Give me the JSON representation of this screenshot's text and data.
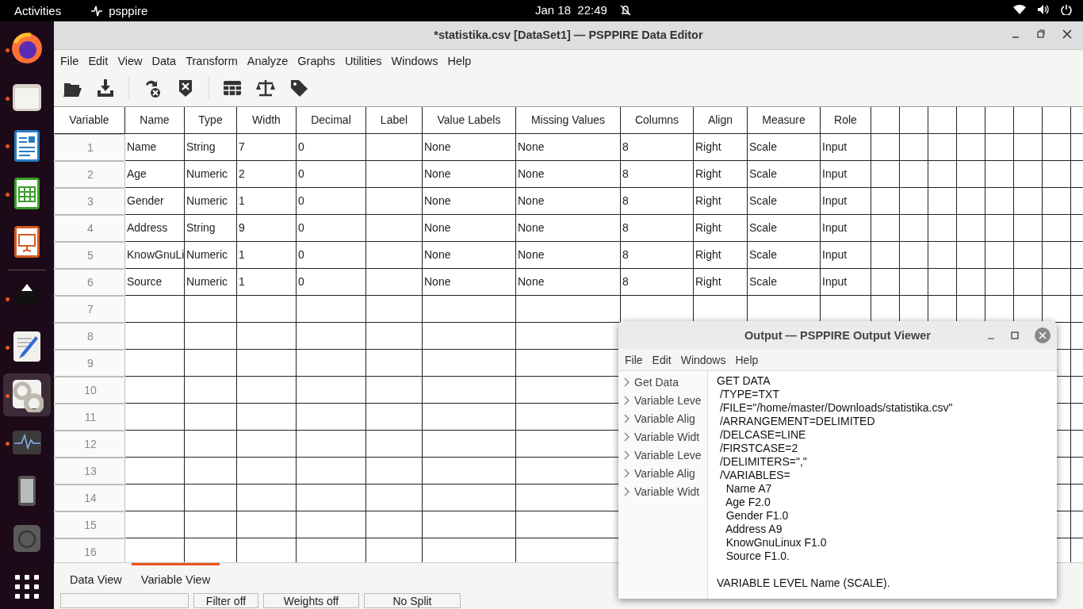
{
  "top_bar": {
    "activities": "Activities",
    "app_name": "psppire",
    "clock": "Jan 18  22:49"
  },
  "dock": [
    {
      "kind": "browser",
      "running": true,
      "selected": false
    },
    {
      "kind": "files",
      "running": true,
      "selected": false
    },
    {
      "kind": "writer",
      "running": true,
      "selected": false
    },
    {
      "kind": "calc",
      "running": true,
      "selected": false
    },
    {
      "kind": "impress",
      "running": false,
      "selected": false
    },
    {
      "kind": "separator"
    },
    {
      "kind": "inkscape",
      "running": true,
      "selected": false
    },
    {
      "kind": "editor",
      "running": true,
      "selected": false
    },
    {
      "kind": "psppire",
      "running": true,
      "selected": true
    },
    {
      "kind": "monitor",
      "running": true,
      "selected": false
    },
    {
      "kind": "phone",
      "running": false,
      "selected": false
    },
    {
      "kind": "disc",
      "running": false,
      "selected": false
    },
    {
      "kind": "apps",
      "running": false,
      "selected": false
    }
  ],
  "editor": {
    "title": "*statistika.csv [DataSet1] — PSPPIRE Data Editor",
    "menu": [
      "File",
      "Edit",
      "View",
      "Data",
      "Transform",
      "Analyze",
      "Graphs",
      "Utilities",
      "Windows",
      "Help"
    ],
    "columns": [
      "Variable",
      "Name",
      "Type",
      "Width",
      "Decimal",
      "Label",
      "Value Labels",
      "Missing Values",
      "Columns",
      "Align",
      "Measure",
      "Role"
    ],
    "rows": [
      {
        "number": "1",
        "cells": [
          "Name",
          "String",
          "7",
          "0",
          "",
          "None",
          "None",
          "8",
          "Right",
          "Scale",
          "Input"
        ]
      },
      {
        "number": "2",
        "cells": [
          "Age",
          "Numeric",
          "2",
          "0",
          "",
          "None",
          "None",
          "8",
          "Right",
          "Scale",
          "Input"
        ]
      },
      {
        "number": "3",
        "cells": [
          "Gender",
          "Numeric",
          "1",
          "0",
          "",
          "None",
          "None",
          "8",
          "Right",
          "Scale",
          "Input"
        ]
      },
      {
        "number": "4",
        "cells": [
          "Address",
          "String",
          "9",
          "0",
          "",
          "None",
          "None",
          "8",
          "Right",
          "Scale",
          "Input"
        ]
      },
      {
        "number": "5",
        "cells": [
          "KnowGnuLi",
          "Numeric",
          "1",
          "0",
          "",
          "None",
          "None",
          "8",
          "Right",
          "Scale",
          "Input"
        ]
      },
      {
        "number": "6",
        "cells": [
          "Source",
          "Numeric",
          "1",
          "0",
          "",
          "None",
          "None",
          "8",
          "Right",
          "Scale",
          "Input"
        ]
      },
      {
        "number": "7"
      },
      {
        "number": "8"
      },
      {
        "number": "9"
      },
      {
        "number": "10"
      },
      {
        "number": "11"
      },
      {
        "number": "12"
      },
      {
        "number": "13"
      },
      {
        "number": "14"
      },
      {
        "number": "15"
      },
      {
        "number": "16"
      }
    ],
    "tabs": [
      {
        "label": "Data View",
        "selected": false
      },
      {
        "label": "Variable View",
        "selected": true
      }
    ],
    "status": [
      "Filter off",
      "Weights off",
      "No Split"
    ]
  },
  "output": {
    "title": "Output — PSPPIRE Output Viewer",
    "menu": [
      "File",
      "Edit",
      "Windows",
      "Help"
    ],
    "tree": [
      "Get Data",
      "Variable Leve",
      "Variable Alig",
      "Variable Widt",
      "Variable Leve",
      "Variable Alig",
      "Variable Widt"
    ],
    "log": [
      {
        "lines": [
          "GET DATA",
          " /TYPE=TXT",
          " /FILE=\"/home/master/Downloads/statistika.csv\"",
          " /ARRANGEMENT=DELIMITED",
          " /DELCASE=LINE",
          " /FIRSTCASE=2",
          " /DELIMITERS=\",\"",
          " /VARIABLES=",
          "   Name A7",
          "   Age F2.0",
          "   Gender F1.0",
          "   Address A9",
          "   KnowGnuLinux F1.0",
          "   Source F1.0."
        ]
      },
      {
        "lines": [
          "VARIABLE LEVEL Name (SCALE)."
        ]
      }
    ]
  }
}
